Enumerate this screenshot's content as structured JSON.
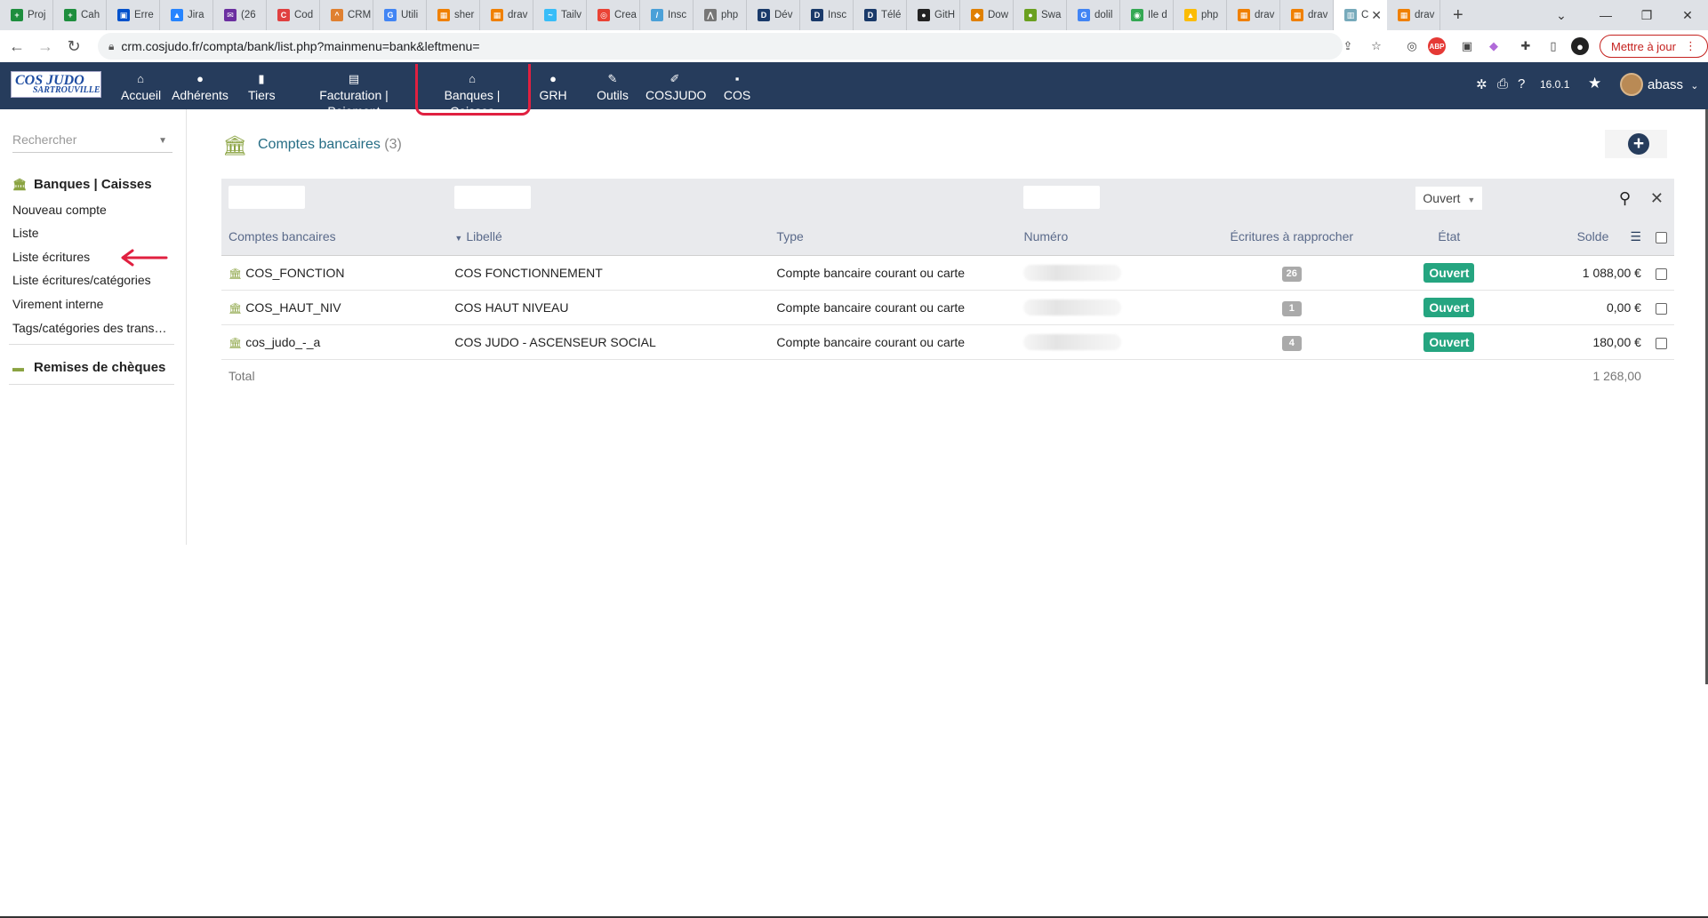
{
  "browser": {
    "tabs": [
      {
        "label": "Proj",
        "color": "#1e8e3e",
        "glyph": "+"
      },
      {
        "label": "Cah",
        "color": "#1e8e3e",
        "glyph": "+"
      },
      {
        "label": "Erre",
        "color": "#0052cc",
        "glyph": "▣"
      },
      {
        "label": "Jira",
        "color": "#2684ff",
        "glyph": "▲"
      },
      {
        "label": "(26",
        "color": "#6b2fa0",
        "glyph": "✉"
      },
      {
        "label": "Cod",
        "color": "#e04040",
        "glyph": "C"
      },
      {
        "label": "CRM",
        "color": "#e08030",
        "glyph": "^"
      },
      {
        "label": "Utili",
        "color": "#4285f4",
        "glyph": "G"
      },
      {
        "label": "sher",
        "color": "#f08000",
        "glyph": "▦"
      },
      {
        "label": "drav",
        "color": "#f08000",
        "glyph": "▦"
      },
      {
        "label": "Tailv",
        "color": "#38bdf8",
        "glyph": "~"
      },
      {
        "label": "Crea",
        "color": "#ea4335",
        "glyph": "◎"
      },
      {
        "label": "Insc",
        "color": "#4aa0d8",
        "glyph": "/"
      },
      {
        "label": "php",
        "color": "#777",
        "glyph": "⋀"
      },
      {
        "label": "Dév",
        "color": "#1a3a6a",
        "glyph": "D"
      },
      {
        "label": "Insc",
        "color": "#1a3a6a",
        "glyph": "D"
      },
      {
        "label": "Télé",
        "color": "#1a3a6a",
        "glyph": "D"
      },
      {
        "label": "GitH",
        "color": "#222",
        "glyph": "●"
      },
      {
        "label": "Dow",
        "color": "#e08000",
        "glyph": "◆"
      },
      {
        "label": "Swa",
        "color": "#6aa020",
        "glyph": "●"
      },
      {
        "label": "dolil",
        "color": "#4285f4",
        "glyph": "G"
      },
      {
        "label": "Ile d",
        "color": "#34a853",
        "glyph": "◉"
      },
      {
        "label": "php",
        "color": "#fbbc04",
        "glyph": "▲"
      },
      {
        "label": "drav",
        "color": "#f08000",
        "glyph": "▦"
      },
      {
        "label": "drav",
        "color": "#f08000",
        "glyph": "▦"
      },
      {
        "label": "C",
        "color": "#7ab",
        "glyph": "▥",
        "active": true
      },
      {
        "label": "drav",
        "color": "#f08000",
        "glyph": "▦"
      }
    ],
    "url": "crm.cosjudo.fr/compta/bank/list.php?mainmenu=bank&leftmenu=",
    "update_label": "Mettre à jour"
  },
  "app": {
    "logo_line1": "COS JUDO",
    "logo_line2": "SARTROUVILLE",
    "menu": [
      {
        "label": "Accueil",
        "icon": "home-icon",
        "glyph": "⌂"
      },
      {
        "label": "Adhérents",
        "icon": "user-icon",
        "glyph": "●"
      },
      {
        "label": "Tiers",
        "icon": "building-icon",
        "glyph": "▮"
      },
      {
        "label": "Facturation | Paiement",
        "icon": "money-icon",
        "glyph": "▤"
      },
      {
        "label": "Banques | Caisses",
        "icon": "bank-icon",
        "glyph": "⌂"
      },
      {
        "label": "GRH",
        "icon": "user-tie-icon",
        "glyph": "●"
      },
      {
        "label": "Outils",
        "icon": "wrench-icon",
        "glyph": "✎"
      },
      {
        "label": "COSJUDO",
        "icon": "edit-icon",
        "glyph": "✐"
      },
      {
        "label": "COS",
        "icon": "note-icon",
        "glyph": "▪"
      }
    ],
    "version": "16.0.1",
    "user": "abass"
  },
  "sidebar": {
    "search_placeholder": "Rechercher",
    "section1_title": "Banques | Caisses",
    "items": [
      "Nouveau compte",
      "Liste",
      "Liste écritures",
      "Liste écritures/catégories",
      "Virement interne",
      "Tags/catégories des transactions"
    ],
    "section2_title": "Remises de chèques"
  },
  "main": {
    "title": "Comptes bancaires",
    "count": "(3)",
    "status_filter": "Ouvert",
    "columns": [
      "Comptes bancaires",
      "Libellé",
      "Type",
      "Numéro",
      "Écritures à rapprocher",
      "État",
      "Solde"
    ],
    "rows": [
      {
        "ref": "COS_FONCTION",
        "label": "COS FONCTIONNEMENT",
        "type": "Compte bancaire courant ou carte",
        "pending": "26",
        "status": "Ouvert",
        "balance": "1 088,00 €"
      },
      {
        "ref": "COS_HAUT_NIV",
        "label": "COS HAUT NIVEAU",
        "type": "Compte bancaire courant ou carte",
        "pending": "1",
        "status": "Ouvert",
        "balance": "0,00 €"
      },
      {
        "ref": "cos_judo_-_a",
        "label": "COS JUDO - ASCENSEUR SOCIAL",
        "type": "Compte bancaire courant ou carte",
        "pending": "4",
        "status": "Ouvert",
        "balance": "180,00 €"
      }
    ],
    "total_label": "Total",
    "total_value": "1 268,00"
  },
  "colors": {
    "nav_bg": "#263c5c",
    "status_green": "#25a580",
    "highlight_red": "#e02040",
    "icon_olive": "#8aa341"
  }
}
